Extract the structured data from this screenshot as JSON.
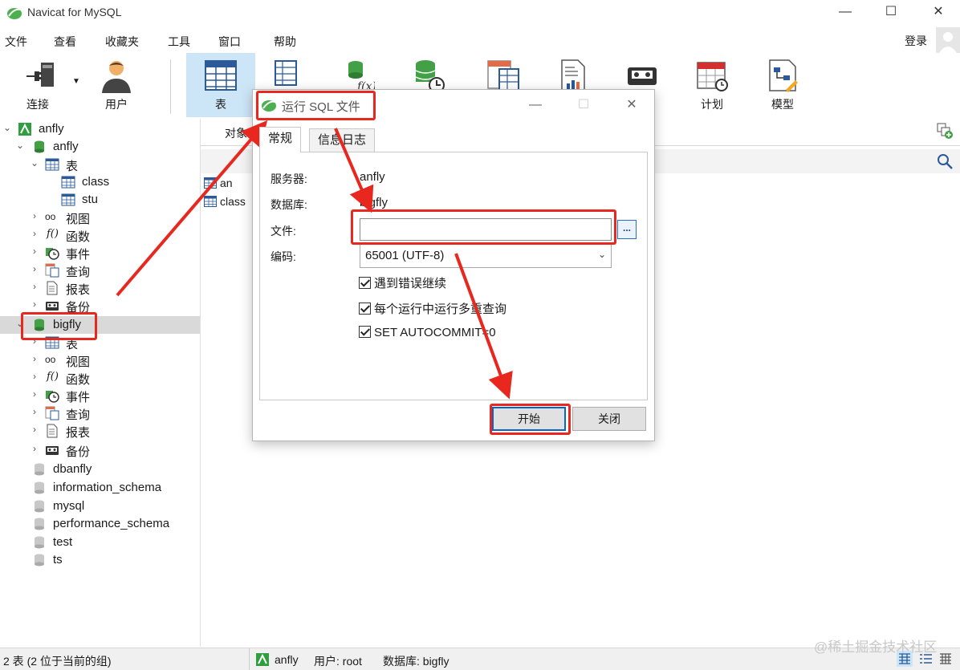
{
  "window": {
    "title": "Navicat for MySQL"
  },
  "menu": {
    "items": [
      "文件",
      "查看",
      "收藏夹",
      "工具",
      "窗口",
      "帮助"
    ],
    "login": "登录"
  },
  "toolbar": {
    "connect": "连接",
    "user": "用户",
    "table": "表",
    "schedule": "计划",
    "model": "模型"
  },
  "tree": {
    "root": "anfly",
    "db1": "anfly",
    "db1_tables": "表",
    "table1": "class",
    "table2": "stu",
    "views": "视图",
    "funcs": "函数",
    "events": "事件",
    "queries": "查询",
    "reports": "报表",
    "backups": "备份",
    "db2": "bigfly",
    "db2_tables": "表",
    "db2_views": "视图",
    "db2_funcs": "函数",
    "db2_events": "事件",
    "db2_queries": "查询",
    "db2_reports": "报表",
    "db2_backups": "备份",
    "db3": "dbanfly",
    "db4": "information_schema",
    "db5": "mysql",
    "db6": "performance_schema",
    "db7": "test",
    "db8": "ts"
  },
  "right": {
    "objects_tab": "对象",
    "list": [
      "an",
      "class"
    ]
  },
  "dialog": {
    "title": "运行 SQL 文件",
    "tab_general": "常规",
    "tab_log": "信息日志",
    "server_label": "服务器:",
    "server_value": "anfly",
    "db_label": "数据库:",
    "db_value": "bigfly",
    "file_label": "文件:",
    "file_value": "",
    "browse": "...",
    "encoding_label": "编码:",
    "encoding_value": "65001 (UTF-8)",
    "opt1": "遇到错误继续",
    "opt2": "每个运行中运行多重查询",
    "opt3": "SET AUTOCOMMIT=0",
    "start": "开始",
    "close": "关闭"
  },
  "status": {
    "left": "2 表 (2 位于当前的组)",
    "conn": "anfly",
    "user": "用户: root",
    "db": "数据库: bigfly"
  },
  "watermark": "@稀土掘金技术社区",
  "colors": {
    "accent": "#cde6f7",
    "annotation": "#e8281e",
    "db_green": "#4caf50"
  }
}
